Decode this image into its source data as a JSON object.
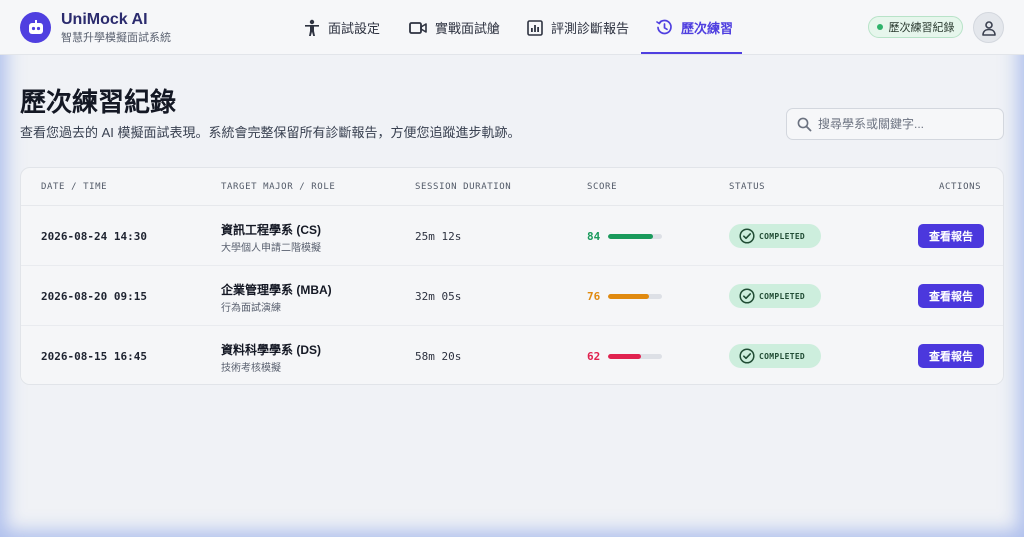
{
  "brand": {
    "name": "UniMock AI",
    "subtitle": "智慧升學模擬面試系統"
  },
  "nav": {
    "items": [
      {
        "label": "面試設定",
        "icon": "person-icon"
      },
      {
        "label": "實戰面試艙",
        "icon": "video-camera-icon"
      },
      {
        "label": "評測診斷報告",
        "icon": "bar-chart-icon"
      },
      {
        "label": "歷次練習",
        "icon": "history-icon",
        "active": true
      }
    ]
  },
  "header": {
    "history_badge": "歷次練習紀錄",
    "avatar_icon": "user-icon"
  },
  "page": {
    "title": "歷次練習紀錄",
    "subtitle": "查看您過去的 AI 模擬面試表現。系統會完整保留所有診斷報告，方便您追蹤進步軌跡。"
  },
  "search": {
    "placeholder": "搜尋學系或關鍵字..."
  },
  "table": {
    "headers": {
      "date": "DATE / TIME",
      "target": "TARGET MAJOR / ROLE",
      "duration": "SESSION DURATION",
      "score": "SCORE",
      "status": "STATUS",
      "actions": "ACTIONS"
    },
    "rows": [
      {
        "date": "2026-08-24 14:30",
        "major": "資訊工程學系 (CS)",
        "role": "大學個人申請二階模擬",
        "duration": "25m 12s",
        "score": "84",
        "score_color": "#1a9a5c",
        "status": "COMPLETED",
        "action": "查看報告"
      },
      {
        "date": "2026-08-20 09:15",
        "major": "企業管理學系 (MBA)",
        "role": "行為面試演練",
        "duration": "32m 05s",
        "score": "76",
        "score_color": "#e08a10",
        "status": "COMPLETED",
        "action": "查看報告"
      },
      {
        "date": "2026-08-15 16:45",
        "major": "資料科學學系 (DS)",
        "role": "技術考核模擬",
        "duration": "58m 20s",
        "score": "62",
        "score_color": "#e0224f",
        "status": "COMPLETED",
        "action": "查看報告"
      }
    ]
  },
  "colors": {
    "accent": "#4f3fe0",
    "success_bg": "#cdeedd"
  }
}
